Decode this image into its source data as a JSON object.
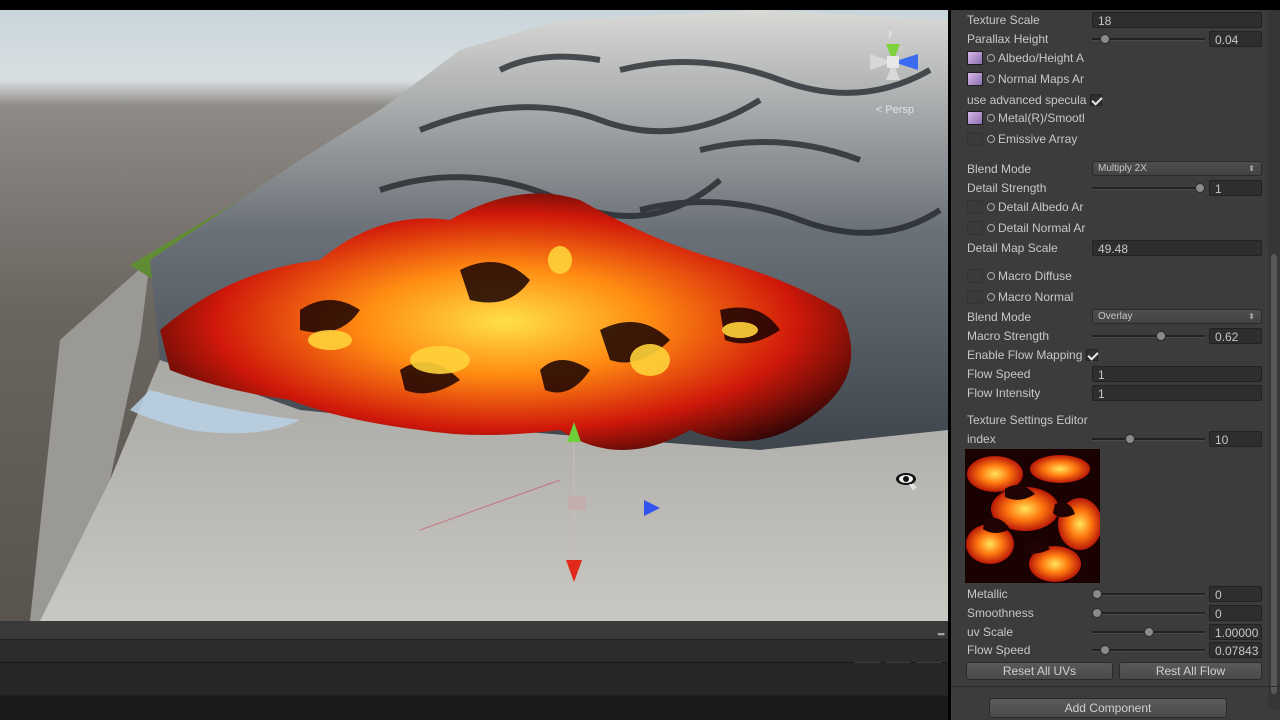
{
  "scene": {
    "view_mode": "< Persp",
    "status_counts": {
      "info": "0",
      "warnings": "0",
      "errors": "0"
    },
    "accent_lava": "#ff5a0a",
    "accent_rock": "#8f8f8f"
  },
  "inspector": {
    "texture_scale": {
      "label": "Texture Scale",
      "value": "18"
    },
    "parallax_height": {
      "label": "Parallax Height",
      "value": "0.04",
      "level": 0.08
    },
    "albedo_height": {
      "label": "Albedo/Height A"
    },
    "normal_maps": {
      "label": "Normal Maps Ar"
    },
    "use_advanced_specular": {
      "label": "use advanced specula",
      "checked": true
    },
    "metal_smooth": {
      "label": "Metal(R)/Smootl"
    },
    "emissive_array": {
      "label": "Emissive Array"
    },
    "blend_mode_1": {
      "label": "Blend Mode",
      "value": "Multiply 2X"
    },
    "detail_strength": {
      "label": "Detail Strength",
      "value": "1",
      "level": 1.0
    },
    "detail_albedo": {
      "label": "Detail Albedo Ar"
    },
    "detail_normal": {
      "label": "Detail Normal Ar"
    },
    "detail_map_scale": {
      "label": "Detail Map Scale",
      "value": "49.48"
    },
    "macro_diffuse": {
      "label": "Macro Diffuse"
    },
    "macro_normal": {
      "label": "Macro Normal"
    },
    "blend_mode_2": {
      "label": "Blend Mode",
      "value": "Overlay"
    },
    "macro_strength": {
      "label": "Macro Strength",
      "value": "0.62",
      "level": 0.62
    },
    "enable_flow_mapping": {
      "label": "Enable Flow Mapping",
      "checked": true
    },
    "flow_speed": {
      "label": "Flow Speed",
      "value": "1"
    },
    "flow_intensity": {
      "label": "Flow Intensity",
      "value": "1"
    },
    "texture_settings_editor": {
      "label": "Texture Settings Editor"
    },
    "index": {
      "label": "index",
      "value": "10",
      "level": 0.32
    },
    "metallic": {
      "label": "Metallic",
      "value": "0",
      "level": 0.0
    },
    "smoothness": {
      "label": "Smoothness",
      "value": "0",
      "level": 0.0
    },
    "uv_scale": {
      "label": "uv Scale",
      "value": "1.00000",
      "level": 0.5
    },
    "flow_speed_2": {
      "label": "Flow Speed",
      "value": "0.07843",
      "level": 0.08
    },
    "reset_all_uvs": "Reset All UVs",
    "rest_all_flow": "Rest All Flow",
    "add_component": "Add Component"
  }
}
